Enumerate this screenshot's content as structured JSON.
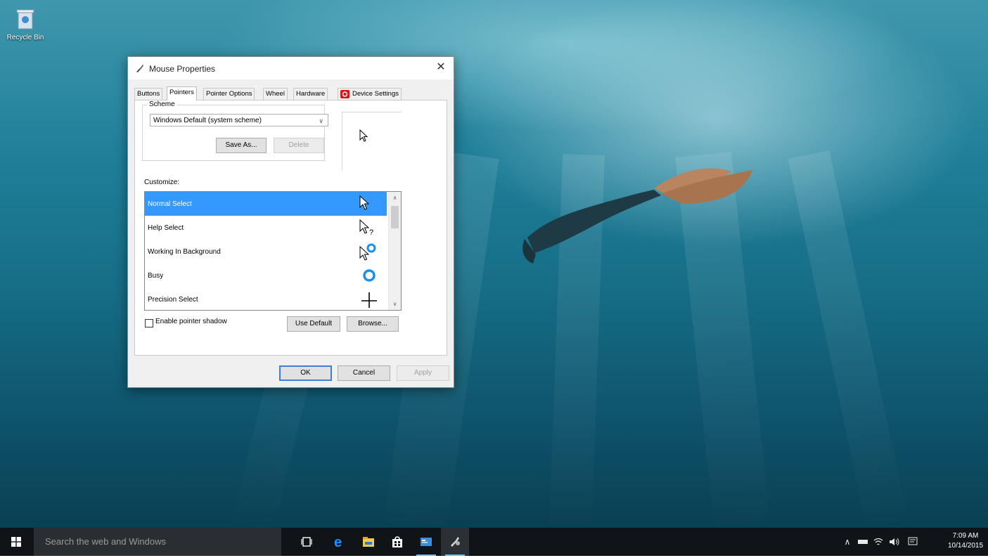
{
  "desktop": {
    "recycle_bin_label": "Recycle Bin"
  },
  "dialog": {
    "title": "Mouse Properties",
    "close_glyph": "✕",
    "tabs": [
      {
        "label": "Buttons"
      },
      {
        "label": "Pointers",
        "active": true
      },
      {
        "label": "Pointer Options"
      },
      {
        "label": "Wheel"
      },
      {
        "label": "Hardware"
      },
      {
        "label": "Device Settings"
      }
    ],
    "scheme": {
      "legend": "Scheme",
      "selected": "Windows Default (system scheme)",
      "save_as": "Save As...",
      "delete": "Delete"
    },
    "customize": {
      "label": "Customize:",
      "items": [
        {
          "label": "Normal Select",
          "cursor": "arrow-cursor-icon",
          "selected": true
        },
        {
          "label": "Help Select",
          "cursor": "help-cursor-icon"
        },
        {
          "label": "Working In Background",
          "cursor": "working-cursor-icon"
        },
        {
          "label": "Busy",
          "cursor": "busy-cursor-icon"
        },
        {
          "label": "Precision Select",
          "cursor": "crosshair-cursor-icon"
        }
      ]
    },
    "pointer_shadow_label": "Enable pointer shadow",
    "pointer_shadow_checked": false,
    "use_default": "Use Default",
    "browse": "Browse...",
    "ok": "OK",
    "cancel": "Cancel",
    "apply": "Apply"
  },
  "taskbar": {
    "search_placeholder": "Search the web and Windows",
    "pinned": [
      "task-view-icon",
      "edge-icon",
      "file-explorer-icon",
      "store-icon",
      "mail-icon",
      "mouse-settings-icon"
    ],
    "clock_time": "7:09 AM",
    "clock_date": "10/14/2015"
  },
  "colors": {
    "selection": "#3399ff",
    "taskbar": "#101418",
    "search_box": "#2a2d31",
    "default_button_border": "#3c7fd3"
  }
}
